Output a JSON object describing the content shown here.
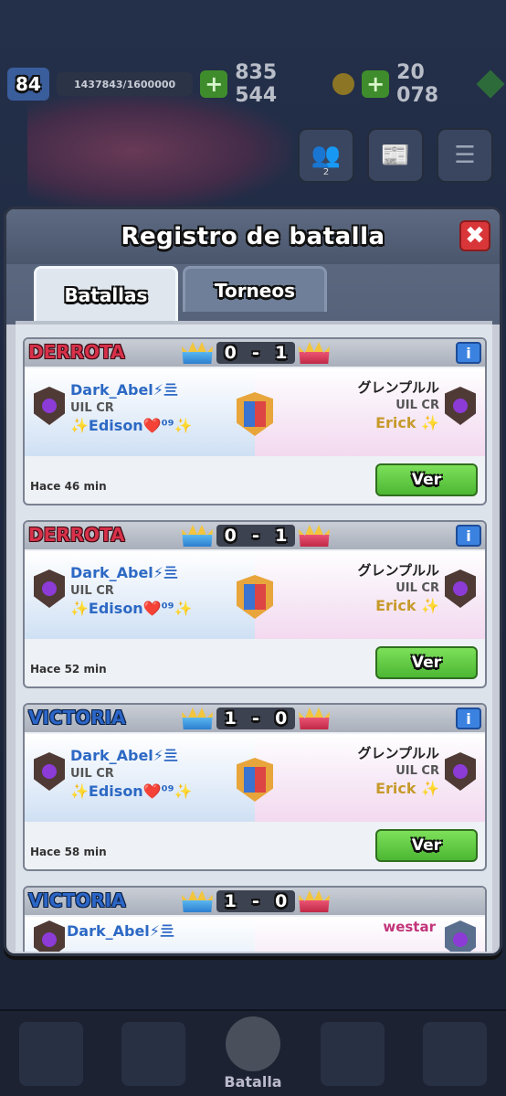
{
  "topbar": {
    "level": "84",
    "xp": "1437843/1600000",
    "gold": "835 544",
    "gems": "20 078"
  },
  "side": {
    "friends_count": "2"
  },
  "modal": {
    "title": "Registro de batalla",
    "close_label": "✖",
    "tabs": [
      {
        "label": "Batallas",
        "active": true
      },
      {
        "label": "Torneos",
        "active": false
      }
    ]
  },
  "battles": [
    {
      "result": "DERROTA",
      "score_left": "0",
      "score_right": "1",
      "player": {
        "name": "Dark_Abel⚡亖",
        "clan": "UIL CR",
        "sub": "✨Edison❤️⁰⁹✨"
      },
      "opponent": {
        "name": "グレンプルル",
        "clan": "UIL CR",
        "sub": "Erick ✨"
      },
      "time": "Hace 46  min",
      "button": "Ver"
    },
    {
      "result": "DERROTA",
      "score_left": "0",
      "score_right": "1",
      "player": {
        "name": "Dark_Abel⚡亖",
        "clan": "UIL CR",
        "sub": "✨Edison❤️⁰⁹✨"
      },
      "opponent": {
        "name": "グレンプルル",
        "clan": "UIL CR",
        "sub": "Erick ✨"
      },
      "time": "Hace 52  min",
      "button": "Ver"
    },
    {
      "result": "VICTORIA",
      "score_left": "1",
      "score_right": "0",
      "player": {
        "name": "Dark_Abel⚡亖",
        "clan": "UIL CR",
        "sub": "✨Edison❤️⁰⁹✨"
      },
      "opponent": {
        "name": "グレンプルル",
        "clan": "UIL CR",
        "sub": "Erick ✨"
      },
      "time": "Hace 58  min",
      "button": "Ver"
    },
    {
      "result": "VICTORIA",
      "score_left": "1",
      "score_right": "0",
      "player": {
        "name": "Dark_Abel⚡亖"
      },
      "opponent": {
        "name": "westar"
      }
    }
  ],
  "nav": {
    "center_label": "Batalla"
  }
}
